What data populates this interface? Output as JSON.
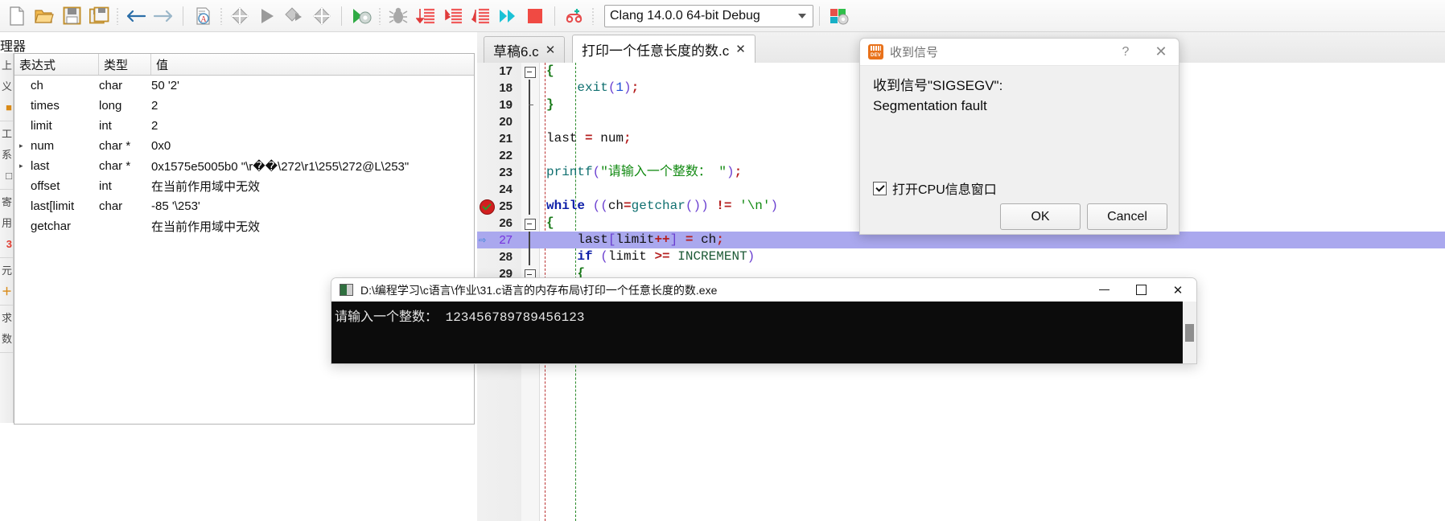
{
  "toolbar": {
    "icons": [
      {
        "name": "new-file-icon",
        "glyph": "new"
      },
      {
        "name": "open-folder-icon",
        "glyph": "open"
      },
      {
        "name": "save-icon",
        "glyph": "save"
      },
      {
        "name": "save-all-icon",
        "glyph": "saveall"
      },
      {
        "name": "back-icon",
        "glyph": "back"
      },
      {
        "name": "forward-icon",
        "glyph": "forward"
      },
      {
        "name": "find-icon",
        "glyph": "find"
      },
      {
        "name": "compile-icon",
        "glyph": "compile"
      },
      {
        "name": "run-icon",
        "glyph": "run"
      },
      {
        "name": "compile-run-icon",
        "glyph": "compilerun"
      },
      {
        "name": "rebuild-all-icon",
        "glyph": "rebuild"
      },
      {
        "name": "debug-icon",
        "glyph": "debug"
      },
      {
        "name": "bug-icon",
        "glyph": "bug"
      },
      {
        "name": "step-over-icon",
        "glyph": "stepover"
      },
      {
        "name": "step-into-icon",
        "glyph": "stepinto"
      },
      {
        "name": "step-out-icon",
        "glyph": "stepout"
      },
      {
        "name": "continue-icon",
        "glyph": "continue"
      },
      {
        "name": "stop-icon",
        "glyph": "stop"
      },
      {
        "name": "profile-icon",
        "glyph": "profile"
      }
    ],
    "compiler_select": "Clang 14.0.0 64-bit Debug",
    "compiler_options_icon": "compiler-options-icon"
  },
  "left_strip": {
    "groups": [
      [
        "上",
        "义",
        "■"
      ],
      [
        "工",
        "系",
        "□"
      ],
      [
        "寄",
        "用",
        "3"
      ],
      [
        "元",
        "＋"
      ],
      [
        "求",
        "数"
      ]
    ]
  },
  "watch_panel": {
    "title": "理器",
    "columns": [
      "表达式",
      "类型",
      "值"
    ],
    "rows": [
      {
        "expand": false,
        "expr": "ch",
        "type": "char",
        "value": "50 '2'"
      },
      {
        "expand": false,
        "expr": "times",
        "type": "long",
        "value": "2"
      },
      {
        "expand": false,
        "expr": "limit",
        "type": "int",
        "value": "2"
      },
      {
        "expand": true,
        "expr": "num",
        "type": "char *",
        "value": "0x0"
      },
      {
        "expand": true,
        "expr": "last",
        "type": "char *",
        "value": "0x1575e5005b0 \"\\r��\\272\\r1\\255\\272@L\\253\""
      },
      {
        "expand": false,
        "expr": "offset",
        "type": "int",
        "value": "在当前作用域中无效"
      },
      {
        "expand": false,
        "expr": "last[limit",
        "type": "char",
        "value": "-85 '\\253'"
      },
      {
        "expand": false,
        "expr": "getchar",
        "type": "",
        "value": "在当前作用域中无效"
      }
    ]
  },
  "editor": {
    "tabs": [
      {
        "label": "草稿6.c",
        "close": "✕",
        "active": false
      },
      {
        "label": "打印一个任意长度的数.c",
        "close": "✕",
        "active": true
      }
    ],
    "lines": [
      {
        "num": "17",
        "marker": "",
        "fold": "open",
        "code": "{"
      },
      {
        "num": "18",
        "marker": "",
        "fold": "",
        "code": "    exit(1);"
      },
      {
        "num": "19",
        "marker": "",
        "fold": "tick",
        "code": "}"
      },
      {
        "num": "20",
        "marker": "",
        "fold": "",
        "code": ""
      },
      {
        "num": "21",
        "marker": "",
        "fold": "",
        "code": "last = num;"
      },
      {
        "num": "22",
        "marker": "",
        "fold": "",
        "code": ""
      },
      {
        "num": "23",
        "marker": "",
        "fold": "",
        "code": "printf(\"请输入一个整数： \");"
      },
      {
        "num": "24",
        "marker": "",
        "fold": "",
        "code": ""
      },
      {
        "num": "25",
        "marker": "breakpoint",
        "fold": "",
        "code": "while ((ch=getchar()) != '\\n')"
      },
      {
        "num": "26",
        "marker": "",
        "fold": "open",
        "code": "{"
      },
      {
        "num": "27",
        "marker": "current",
        "fold": "",
        "code": "    last[limit++] = ch;"
      },
      {
        "num": "28",
        "marker": "",
        "fold": "",
        "code": "    if (limit >= INCREMENT)"
      },
      {
        "num": "29",
        "marker": "",
        "fold": "open",
        "code": "    {"
      }
    ]
  },
  "signal_dialog": {
    "icon": "dev-cpp-icon",
    "icon_text": "DEV",
    "title": "收到信号",
    "help_button": "?",
    "close_button": "✕",
    "message_line1": "收到信号\"SIGSEGV\":",
    "message_line2": "Segmentation fault",
    "checkbox_label": "打开CPU信息窗口",
    "checkbox_checked": true,
    "ok_label": "OK",
    "cancel_label": "Cancel"
  },
  "console_window": {
    "icon": "console-app-icon",
    "title": "D:\\编程学习\\c语言\\作业\\31.c语言的内存布局\\打印一个任意长度的数.exe",
    "minimize": "—",
    "maximize": "□",
    "close": "✕",
    "output": "请输入一个整数： 123456789789456123"
  },
  "colors": {
    "accent_purple": "#aaa8ee",
    "breakpoint_red": "#d21f1f",
    "dev_orange": "#e8711a",
    "console_black": "#0c0c0c"
  }
}
